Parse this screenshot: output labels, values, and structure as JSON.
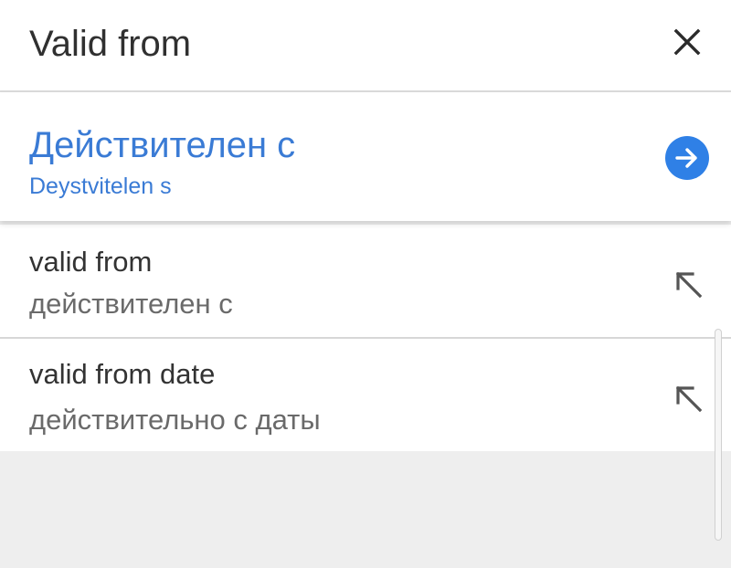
{
  "header": {
    "title": "Valid from",
    "close_icon": "close-icon"
  },
  "result": {
    "translation": "Действителен с",
    "transliteration": "Deystvitelen s",
    "go_icon": "arrow-right-circle-icon",
    "accent_color": "#2f80e6"
  },
  "suggestions": [
    {
      "english": "valid from",
      "russian": "действителен с",
      "icon": "arrow-up-left-icon"
    },
    {
      "english": "valid from date",
      "russian": "действительно с даты",
      "icon": "arrow-up-left-icon"
    }
  ]
}
